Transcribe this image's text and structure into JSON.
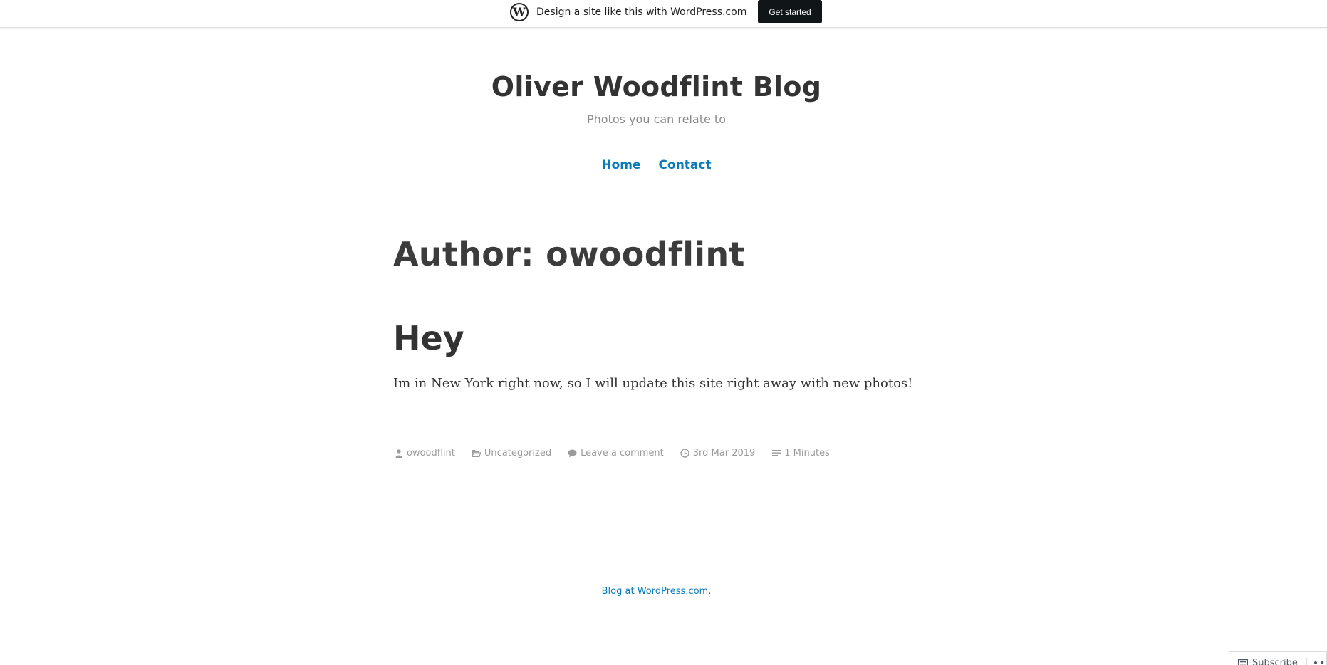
{
  "banner": {
    "logo_letter": "W",
    "text": "Design a site like this with WordPress.com",
    "cta_label": "Get started"
  },
  "site": {
    "title": "Oliver Woodflint Blog",
    "description": "Photos you can relate to"
  },
  "nav": {
    "items": [
      {
        "label": "Home"
      },
      {
        "label": "Contact"
      }
    ]
  },
  "archive": {
    "title": "Author: owoodflint"
  },
  "post": {
    "title": "Hey",
    "content": "Im in New York right now, so I will update this site right away with new photos!",
    "meta": {
      "author": "owoodflint",
      "category": "Uncategorized",
      "comments": "Leave a comment",
      "date": "3rd Mar 2019",
      "reading_time": "1 Minutes"
    }
  },
  "footer": {
    "credit": "Blog at WordPress.com."
  },
  "actions_bar": {
    "subscribe_label": "Subscribe",
    "more_label": "•••"
  },
  "colors": {
    "link": "#0a7ab8",
    "heading": "#333333",
    "meta": "#9a9a9a",
    "banner_button": "#101517"
  }
}
